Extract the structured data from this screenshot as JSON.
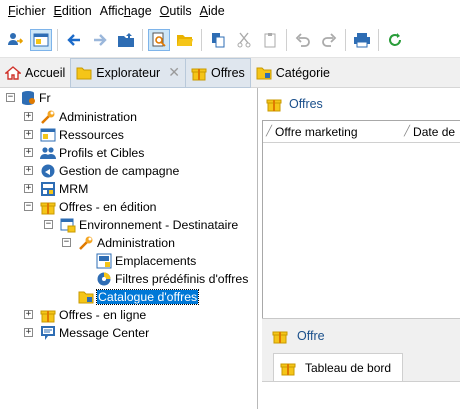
{
  "menu": {
    "items": [
      {
        "label": "Fichier",
        "accel": "F",
        "rest": "ichier"
      },
      {
        "label": "Edition",
        "accel": "E",
        "rest": "dition"
      },
      {
        "label": "Affichage",
        "pre": "Affic",
        "accel": "h",
        "rest": "age"
      },
      {
        "label": "Outils",
        "accel": "O",
        "rest": "utils"
      },
      {
        "label": "Aide",
        "accel": "A",
        "rest": "ide"
      }
    ]
  },
  "tabs": {
    "home": "Accueil",
    "explorer": "Explorateur",
    "offers": "Offres",
    "category": "Catégorie"
  },
  "tree": {
    "root": "Fr",
    "administration": "Administration",
    "resources": "Ressources",
    "profiles": "Profils et Cibles",
    "campaigns": "Gestion de campagne",
    "mrm": "MRM",
    "offers_edit": "Offres - en édition",
    "env": "Environnement - Destinataire",
    "env_admin": "Administration",
    "placements": "Emplacements",
    "filters": "Filtres prédéfinis d'offres",
    "catalog": "Catalogue d'offres",
    "offers_online": "Offres - en ligne",
    "message_center": "Message Center"
  },
  "right": {
    "title": "Offres",
    "columns": [
      "Offre marketing",
      "Date de"
    ],
    "detail_title": "Offre",
    "detail_tab": "Tableau de bord"
  },
  "colors": {
    "accent": "#0078d7",
    "folder": "#f5c518",
    "selected_tab": "#dfe6ee"
  }
}
